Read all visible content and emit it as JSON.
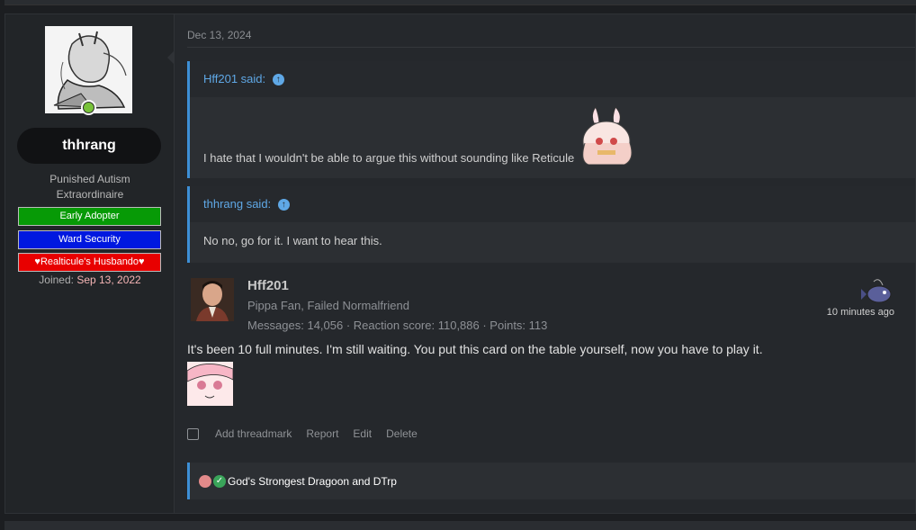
{
  "post": {
    "author": {
      "username": "thhrang",
      "title_line1": "Punished Autism",
      "title_line2": "Extraordinaire",
      "banners": [
        "Early Adopter",
        "Ward Security",
        "♥Realticule's Husbando♥"
      ],
      "joined_label": "Joined:",
      "joined_date": "Sep 13, 2022"
    },
    "date": "Dec 13, 2024",
    "quotes": [
      {
        "author_said": "Hff201 said:",
        "text": "I hate that I wouldn't be able to argue this without sounding like Reticule"
      },
      {
        "author_said": "thhrang said:",
        "text": "No no, go for it. I want to hear this."
      }
    ],
    "reply": {
      "username": "Hff201",
      "user_title": "Pippa Fan, Failed Normalfriend",
      "stats": "Messages: 14,056 · Reaction score: 110,886 · Points: 113",
      "time": "10 minutes ago",
      "message": "It's been 10 full minutes. I'm still waiting. You put this card on the table yourself, now you have to play it."
    },
    "actions": {
      "threadmark": "Add threadmark",
      "report": "Report",
      "edit": "Edit",
      "delete": "Delete"
    },
    "reactions_text": "God's Strongest Dragoon and DTrp",
    "colors": {
      "accent": "#3d8fd6",
      "banner_green": "#079a06",
      "banner_blue": "#0018e0",
      "banner_red": "#e80000"
    }
  }
}
